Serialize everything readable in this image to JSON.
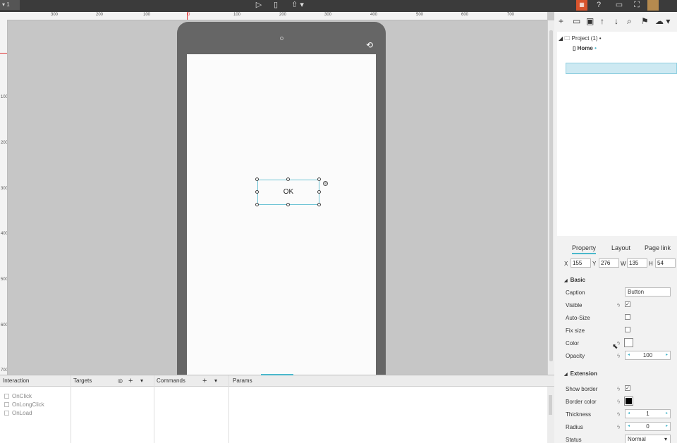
{
  "topbar": {
    "tab_label": "▾ 1",
    "icons": [
      "play-icon",
      "phone-icon",
      "cloud-upload-icon",
      "dev-icon",
      "help-icon",
      "window-icon",
      "fullscreen-icon",
      "avatar"
    ]
  },
  "ruler": {
    "h_labels": [
      "300",
      "200",
      "100",
      "0",
      "100",
      "200",
      "300",
      "400",
      "500",
      "600",
      "700"
    ],
    "v_labels": [
      "100",
      "200",
      "300",
      "400",
      "500",
      "600",
      "700"
    ]
  },
  "canvas": {
    "button_caption": "OK"
  },
  "tree": {
    "project_label": "Project (1)",
    "home_label": "Home"
  },
  "property_tabs": [
    "Property",
    "Layout",
    "Page link"
  ],
  "geometry": {
    "x_label": "X",
    "x": "155",
    "y_label": "Y",
    "y": "276",
    "w_label": "W",
    "w": "135",
    "h_label": "H",
    "h": "54"
  },
  "basic": {
    "title": "Basic",
    "caption_label": "Caption",
    "caption_value": "Button",
    "visible_label": "Visible",
    "visible_checked": "✓",
    "autosize_label": "Auto-Size",
    "fixsize_label": "Fix size",
    "color_label": "Color",
    "color_value": "#ffffff",
    "opacity_label": "Opacity",
    "opacity_value": "100"
  },
  "extension": {
    "title": "Extension",
    "showborder_label": "Show border",
    "showborder_checked": "✓",
    "bordercolor_label": "Border color",
    "bordercolor_value": "#000000",
    "thickness_label": "Thickness",
    "thickness_value": "1",
    "radius_label": "Radius",
    "radius_value": "0",
    "status_label": "Status",
    "status_value": "Normal"
  },
  "bottom": {
    "interaction_label": "Interaction",
    "targets_label": "Targets",
    "commands_label": "Commands",
    "params_label": "Params",
    "events": [
      "OnClick",
      "OnLongClick",
      "OnLoad"
    ]
  },
  "colors": {
    "accent": "#4bb8cc",
    "phone": "#666666",
    "topbar": "#3b3b3b"
  }
}
